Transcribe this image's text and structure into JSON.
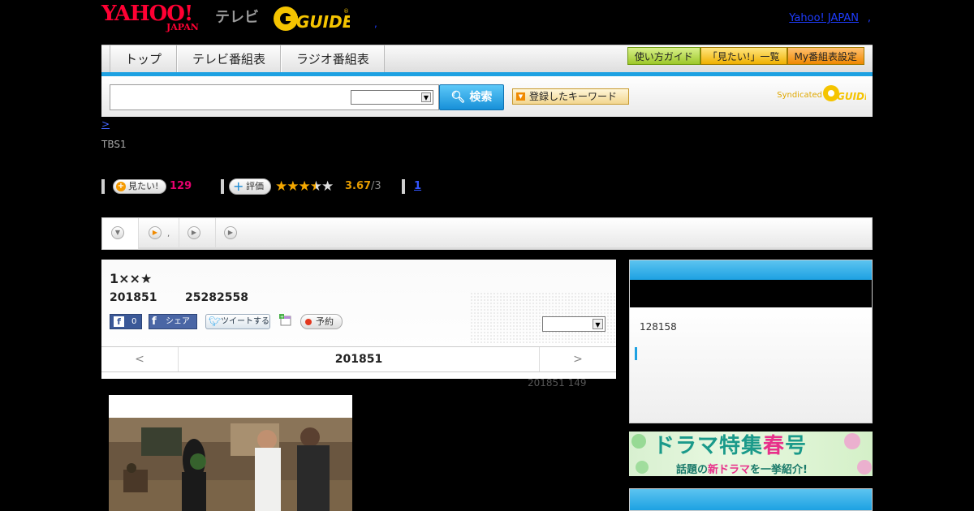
{
  "header": {
    "logo_yahoo": "YAHOO!",
    "logo_japan": "JAPAN",
    "logo_tv": "テレビ",
    "logo_gguide": "G GUIDE",
    "link": "Yahoo! JAPAN",
    "sep": ",",
    "dot": ","
  },
  "nav": {
    "tabs": [
      "トップ",
      "テレビ番組表",
      "ラジオ番組表"
    ],
    "buttons": [
      "使い方ガイド",
      "「見たい!」一覧",
      "My番組表設定"
    ]
  },
  "search": {
    "button": "検索",
    "keyword": "登録したキーワード",
    "syndicated": "Syndicated"
  },
  "crumb": ">",
  "channel": "TBS1",
  "stats": {
    "mitai": "見たい!",
    "mitai_count": "129",
    "hyoka": "評価",
    "rating": "3.67",
    "rating_sub": "/3",
    "review": "1",
    "stars_filled": 3.5
  },
  "tabs": {
    "dot": ","
  },
  "program": {
    "title": "1××★",
    "date": "201851",
    "time": "25282558",
    "fb_count": "0",
    "fb_share": "シェア",
    "tweet": "ツイートする",
    "yoyaku": "予約",
    "pager_prev": "<",
    "pager_mid": "201851",
    "pager_next": ">"
  },
  "below_meta": "201851  149",
  "sidebar": {
    "count": "128158"
  },
  "banner": {
    "main_a": "ドラマ特集",
    "main_b": "春",
    "main_c": "号",
    "sub_a": "話題の",
    "sub_b": "新ドラマ",
    "sub_c": "を一挙紹介!"
  },
  "colors": {
    "accent_blue": "#1da1e2",
    "yahoo_red": "#ff0033",
    "pink": "#e6006e",
    "star": "#f5a800"
  }
}
